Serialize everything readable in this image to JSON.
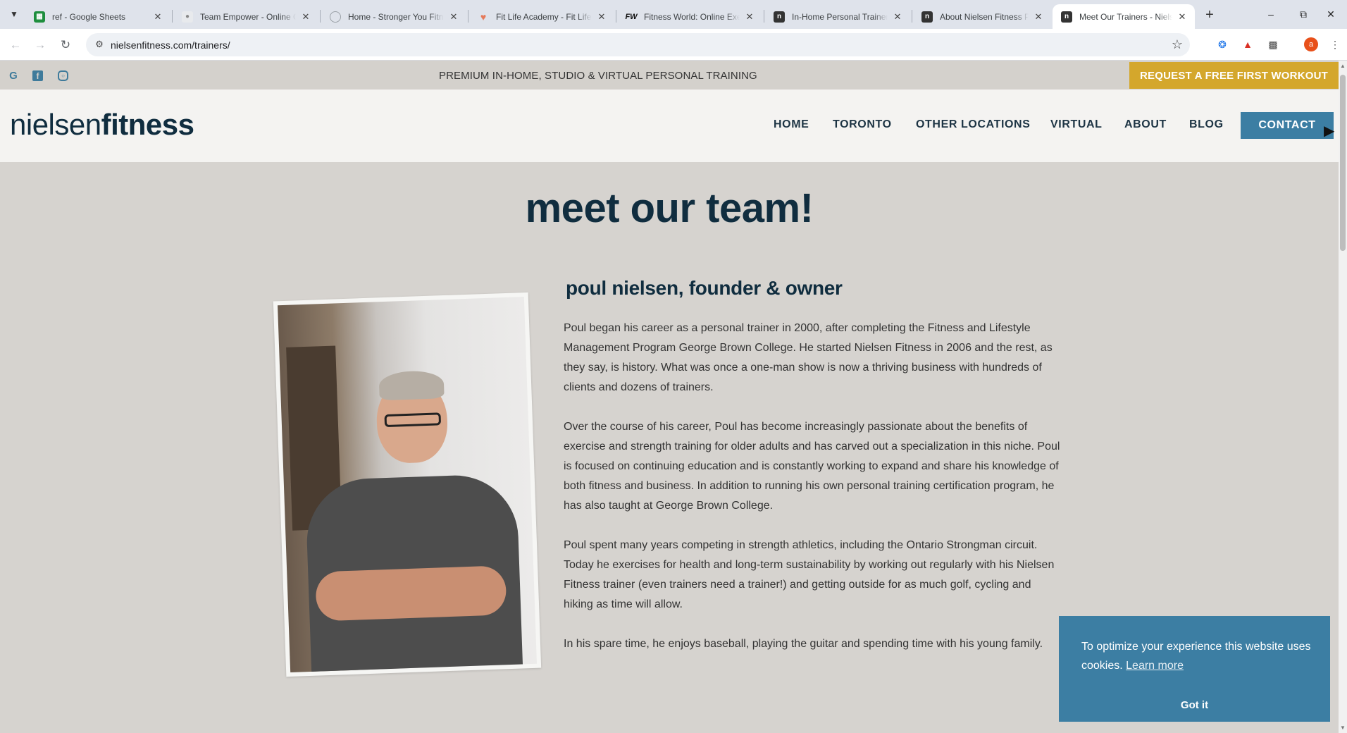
{
  "browser": {
    "tabs": [
      {
        "title": "ref - Google Sheets",
        "favicon": "sheets-icon",
        "color": "#1e8e3e"
      },
      {
        "title": "Team Empower - Online Coaching",
        "favicon": "team-empower-icon",
        "color": "#9aa0a6"
      },
      {
        "title": "Home - Stronger You Fitness",
        "favicon": "globe-icon",
        "color": "#9aa0a6"
      },
      {
        "title": "Fit Life Academy - Fit Life",
        "favicon": "fitlife-icon",
        "color": "#e57a5a"
      },
      {
        "title": "Fitness World: Online Exercise",
        "favicon": "fw-icon",
        "color": "#111111"
      },
      {
        "title": "In-Home Personal Trainers",
        "favicon": "nielsen-icon",
        "color": "#333333"
      },
      {
        "title": "About Nielsen Fitness Personal",
        "favicon": "nielsen-icon",
        "color": "#333333"
      },
      {
        "title": "Meet Our Trainers - Nielsen Fitness",
        "favicon": "nielsen-icon",
        "color": "#333333"
      }
    ],
    "url": "nielsenfitness.com/trainers/",
    "profile_initial": "a"
  },
  "site": {
    "tagline": "PREMIUM IN-HOME, STUDIO & VIRTUAL PERSONAL TRAINING",
    "cta_top": "REQUEST A FREE FIRST WORKOUT",
    "logo_light": "nielsen",
    "logo_bold": "fitness",
    "nav": [
      "HOME",
      "TORONTO",
      "OTHER LOCATIONS",
      "VIRTUAL",
      "ABOUT",
      "BLOG"
    ],
    "nav_contact": "CONTACT",
    "colors": {
      "brand_dark": "#102d3f",
      "accent_blue": "#3c7ea3",
      "accent_gold": "#d4a72c",
      "background": "#d6d3cf"
    }
  },
  "main": {
    "heading": "meet our team!",
    "bio_title": "poul nielsen, founder & owner",
    "bio_paragraphs": [
      "Poul began his career as a personal trainer in 2000, after completing the Fitness and Lifestyle Management Program George Brown College. He started Nielsen Fitness in 2006 and the rest, as they say, is history. What was once a one-man show is now a thriving business with hundreds of clients and dozens of trainers.",
      "Over the course of his career, Poul has become increasingly passionate about the benefits of exercise and strength training for older adults and has carved out a specialization in this niche. Poul is focused on continuing education and is constantly working to expand and share his knowledge of both fitness and business. In addition to running his own personal training certification program, he has also taught at George Brown College.",
      "Poul spent many years competing in strength athletics, including the Ontario Strongman circuit. Today he exercises for health and long-term sustainability by working out regularly with his Nielsen Fitness trainer (even trainers need a trainer!) and getting outside for as much golf, cycling and hiking as time will allow.",
      "In his spare time, he enjoys baseball, playing the guitar and spending time with his young family."
    ]
  },
  "cookie_banner": {
    "message": "To optimize your experience this website uses cookies.",
    "learn_more": "Learn more",
    "accept": "Got it"
  }
}
